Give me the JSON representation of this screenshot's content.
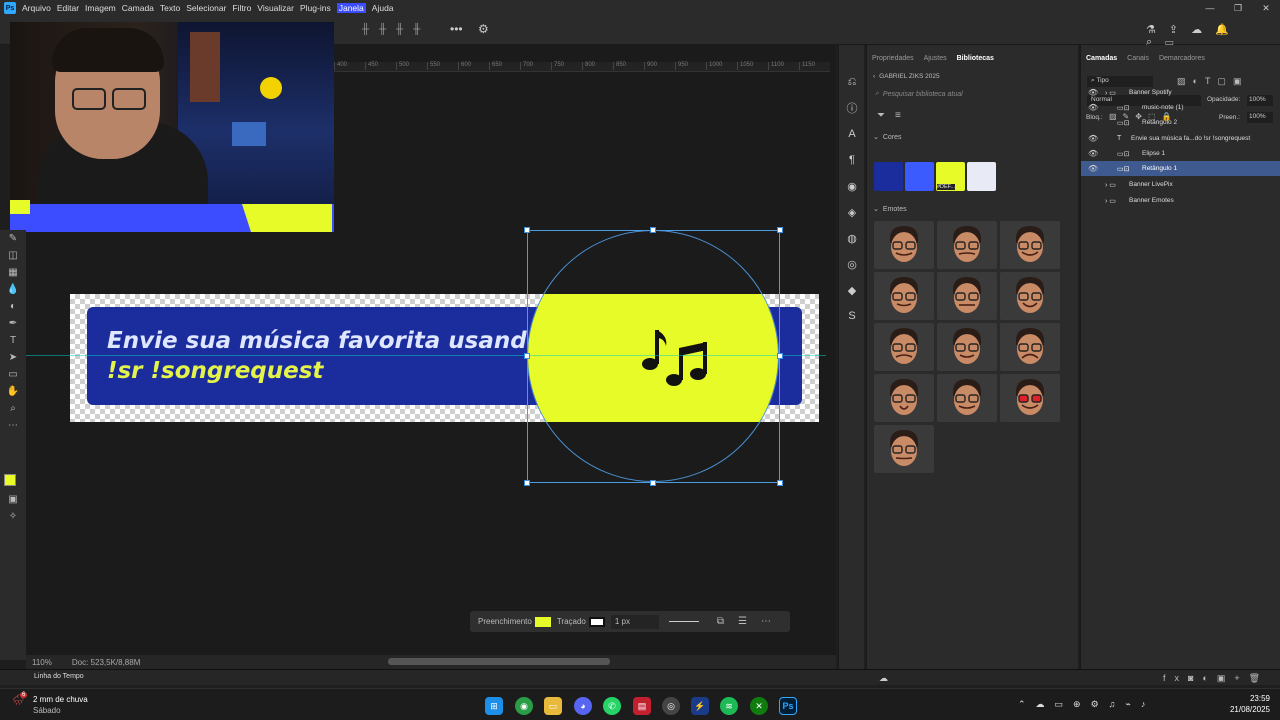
{
  "menu": {
    "items": [
      "Arquivo",
      "Editar",
      "Imagem",
      "Camada",
      "Texto",
      "Selecionar",
      "Filtro",
      "Visualizar",
      "Plug-ins",
      "Janela",
      "Ajuda"
    ],
    "highlighted": "Janela"
  },
  "canvas": {
    "banner_line1": "Envie sua música favorita usando",
    "banner_line2": "!sr !songrequest",
    "ruler_ticks": [
      "400",
      "450",
      "500",
      "550",
      "600",
      "650",
      "700",
      "750",
      "800",
      "850",
      "900",
      "950",
      "1000",
      "1050",
      "1100",
      "1150"
    ],
    "zoom": "110%",
    "doc_info": "Doc: 523,5K/8,88M"
  },
  "context_bar": {
    "fill_label": "Preenchimento",
    "stroke_label": "Traçado",
    "stroke_width": "1 px",
    "fill_color": "#e7fb29"
  },
  "timeline": {
    "label": "Linha do Tempo"
  },
  "libraries": {
    "tabs": [
      "Propriedades",
      "Ajustes",
      "Bibliotecas"
    ],
    "active_tab": "Bibliotecas",
    "library_name": "GABRIEL ZIKS 2025",
    "search_placeholder": "Pesquisar biblioteca atual",
    "colors_label": "Cores",
    "emotes_label": "Emotes",
    "colors": [
      "#1b2d9c",
      "#3b5bff",
      "#e7fb29",
      "#e8eaf6"
    ],
    "color_tooltip": "#DEF..."
  },
  "layers": {
    "tabs": [
      "Camadas",
      "Canais",
      "Demarcadores"
    ],
    "active_tab": "Camadas",
    "filter_label": "Tipo",
    "blend_mode": "Normal",
    "opacity_label": "Opacidade:",
    "opacity_value": "100%",
    "lock_label": "Bloq.:",
    "fill_label": "Preen.:",
    "fill_value": "100%",
    "items": [
      {
        "name": "Banner Spotify",
        "type": "group",
        "visible": true,
        "indent": 0
      },
      {
        "name": "music-note (1)",
        "type": "shape",
        "visible": true,
        "indent": 1
      },
      {
        "name": "Retângulo 2",
        "type": "shape",
        "visible": false,
        "indent": 1
      },
      {
        "name": "Envie sua música fa...do !sr !songrequest",
        "type": "text",
        "visible": true,
        "indent": 1
      },
      {
        "name": "Elipse 1",
        "type": "shape",
        "visible": true,
        "indent": 1
      },
      {
        "name": "Retângulo 1",
        "type": "shape",
        "visible": true,
        "indent": 1,
        "selected": true
      },
      {
        "name": "Banner LivePix",
        "type": "group",
        "visible": false,
        "indent": 0
      },
      {
        "name": "Banner Emotes",
        "type": "group",
        "visible": false,
        "indent": 0
      }
    ]
  },
  "taskbar": {
    "weather_temp": "6",
    "weather_text": "2 mm de chuva",
    "weather_sub": "Sábado",
    "time": "23:59",
    "date": "21/08/2025"
  }
}
